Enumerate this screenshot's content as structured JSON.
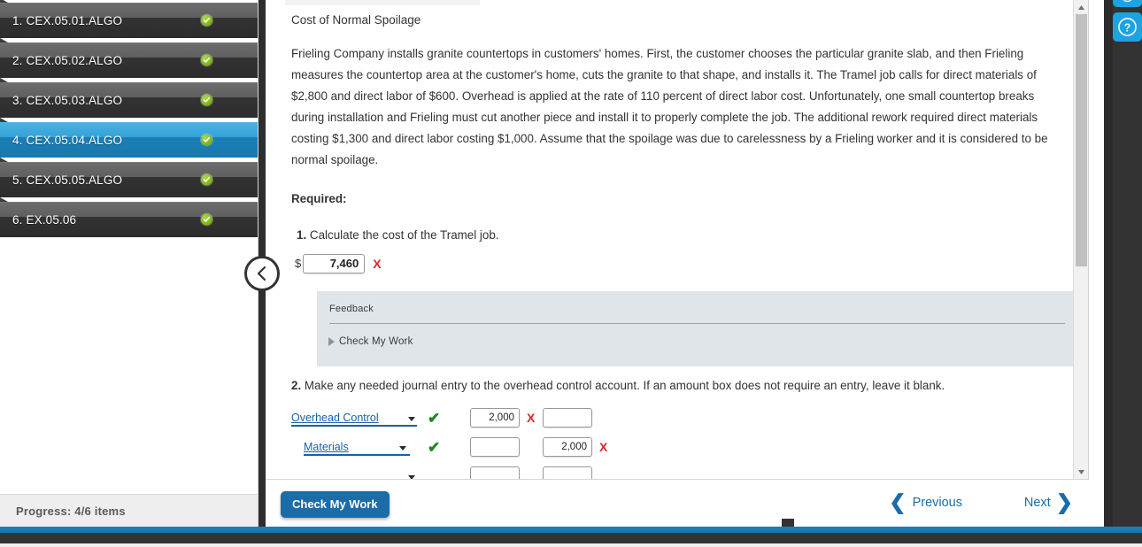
{
  "sidebar": {
    "items": [
      {
        "label": "1. CEX.05.01.ALGO",
        "status_icon": "check-circle-green",
        "active": false
      },
      {
        "label": "2. CEX.05.02.ALGO",
        "status_icon": "check-circle-green",
        "active": false
      },
      {
        "label": "3. CEX.05.03.ALGO",
        "status_icon": "check-circle-green",
        "active": false
      },
      {
        "label": "4. CEX.05.04.ALGO",
        "status_icon": "check-circle-green",
        "active": true
      },
      {
        "label": "5. CEX.05.05.ALGO",
        "status_icon": "check-circle-green",
        "active": false
      },
      {
        "label": "6. EX.05.06",
        "status_icon": "check-circle-green",
        "active": false
      }
    ],
    "progress_label": "Progress:  4/6 items",
    "collapse_icon": "chevron-left-icon"
  },
  "question": {
    "title": "Cost of Normal Spoilage",
    "paragraph": "Frieling Company installs granite countertops in customers' homes. First, the customer chooses the particular granite slab, and then Frieling measures the countertop area at the customer's home, cuts the granite to that shape, and installs it. The Tramel job calls for direct materials of $2,800 and direct labor of $600. Overhead is applied at the rate of 110 percent of direct labor cost. Unfortunately, one small countertop breaks during installation and Frieling must cut another piece and install it to properly complete the job. The additional rework required direct materials costing $1,300 and direct labor costing $1,000. Assume that the spoilage was due to carelessness by a Frieling worker and it is considered to be normal spoilage.",
    "required_label": "Required:",
    "step1": {
      "number": "1.",
      "text": "Calculate the cost of the Tramel job.",
      "currency_symbol": "$",
      "value": "7,460",
      "mark": "X",
      "mark_state": "incorrect"
    },
    "step2": {
      "number": "2.",
      "text": "Make any needed journal entry to the overhead control account. If an amount box does not require an entry, leave it blank.",
      "rows": [
        {
          "account": "Overhead Control",
          "account_mark": "✔",
          "account_mark_state": "correct",
          "debit": "2,000",
          "debit_mark": "X",
          "debit_mark_state": "incorrect",
          "credit": "",
          "credit_mark": "",
          "credit_mark_state": "",
          "indented": false
        },
        {
          "account": "Materials",
          "account_mark": "✔",
          "account_mark_state": "correct",
          "debit": "",
          "debit_mark": "",
          "debit_mark_state": "",
          "credit": "2,000",
          "credit_mark": "X",
          "credit_mark_state": "incorrect",
          "indented": true
        },
        {
          "account": "",
          "account_mark": "",
          "account_mark_state": "",
          "debit": "",
          "debit_mark": "",
          "debit_mark_state": "",
          "credit": "",
          "credit_mark": "",
          "credit_mark_state": "",
          "indented": false
        }
      ]
    }
  },
  "feedback": {
    "title": "Feedback",
    "check_my_work_label": "Check My Work",
    "arrow_icon": "triangle-right-icon",
    "background_color": "#dfe5e8"
  },
  "bottom_bar": {
    "check_my_work_button": "Check My Work",
    "previous_label": "Previous",
    "next_label": "Next",
    "previous_icon": "chevron-left-icon",
    "next_icon": "chevron-right-icon"
  },
  "right_rail": {
    "help_icon": "question-mark-circle-icon",
    "top_icon": "partial-icon"
  },
  "colors": {
    "accent_blue": "#1b6ca8",
    "active_nav_blue": "#1878ad",
    "rail_blue": "#1fa2e0",
    "incorrect_red": "#d8242a",
    "correct_green": "#1a8a22",
    "status_green": "#7cb317"
  }
}
